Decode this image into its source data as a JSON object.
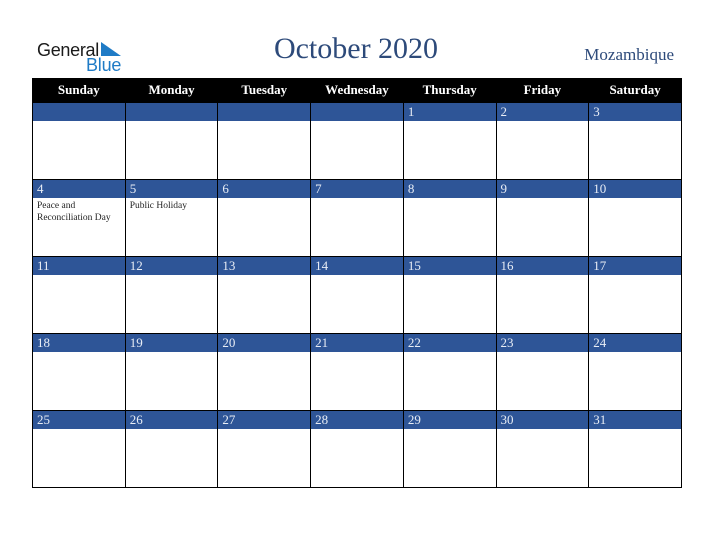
{
  "logo": {
    "word1": "General",
    "word2": "Blue"
  },
  "title": "October 2020",
  "country": "Mozambique",
  "weekdays": [
    "Sunday",
    "Monday",
    "Tuesday",
    "Wednesday",
    "Thursday",
    "Friday",
    "Saturday"
  ],
  "weeks": [
    [
      {
        "day": ""
      },
      {
        "day": ""
      },
      {
        "day": ""
      },
      {
        "day": ""
      },
      {
        "day": "1"
      },
      {
        "day": "2"
      },
      {
        "day": "3"
      }
    ],
    [
      {
        "day": "4",
        "event": "Peace and Reconciliation Day"
      },
      {
        "day": "5",
        "event": "Public Holiday"
      },
      {
        "day": "6"
      },
      {
        "day": "7"
      },
      {
        "day": "8"
      },
      {
        "day": "9"
      },
      {
        "day": "10"
      }
    ],
    [
      {
        "day": "11"
      },
      {
        "day": "12"
      },
      {
        "day": "13"
      },
      {
        "day": "14"
      },
      {
        "day": "15"
      },
      {
        "day": "16"
      },
      {
        "day": "17"
      }
    ],
    [
      {
        "day": "18"
      },
      {
        "day": "19"
      },
      {
        "day": "20"
      },
      {
        "day": "21"
      },
      {
        "day": "22"
      },
      {
        "day": "23"
      },
      {
        "day": "24"
      }
    ],
    [
      {
        "day": "25"
      },
      {
        "day": "26"
      },
      {
        "day": "27"
      },
      {
        "day": "28"
      },
      {
        "day": "29"
      },
      {
        "day": "30"
      },
      {
        "day": "31"
      }
    ]
  ],
  "colors": {
    "header_bg": "#000000",
    "band_bg": "#2e5597",
    "title": "#2d4a7a",
    "logo_blue": "#1f7bc6"
  }
}
